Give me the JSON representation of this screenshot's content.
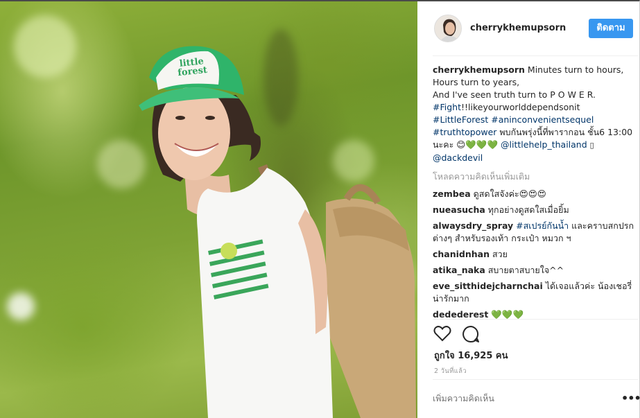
{
  "post": {
    "photo_cap_text": "little forest"
  },
  "header": {
    "username": "cherrykhemupsorn",
    "follow_label": "ติดตาม"
  },
  "caption": {
    "username": "cherrykhemupsorn",
    "line1": "Minutes turn to hours,",
    "line2": "Hours turn to years,",
    "line3": "And I've seen truth turn to P O W E R.",
    "hashtag1": "#Fight",
    "text1": "!!likeyourworlddependsonit",
    "hashtag2": "#LittleForest",
    "hashtag3": "#aninconvenientsequel",
    "hashtag4": "#truthtopower",
    "text2": " พบกันพรุ่งนี้ที่พารากอน ชั้น6 13:00 นะคะ 😊",
    "hearts": "💚💚💚",
    "mention1": "@littlehelp_thailand",
    "mention2": "@dackdevil"
  },
  "load_more": "โหลดความคิดเห็นเพิ่มเติม",
  "comments": [
    {
      "user": "zembea",
      "text": "ดูสดใสจังค่ะ😍😍😍"
    },
    {
      "user": "nueasucha",
      "text": "ทุกอย่างดูสดใสเมื่อยิ้ม"
    },
    {
      "user": "alwaysdry_spray",
      "hashtag": "#สเปรย์กันน้ำ",
      "text": " และคราบสกปรกต่างๆ สำหรับรองเท้า กระเป๋า หมวก ฯ"
    },
    {
      "user": "chanidnhan",
      "text": "สวย"
    },
    {
      "user": "atika_naka",
      "text": "สบายตาสบายใจ^^"
    },
    {
      "user": "eve_sitthidejcharnchai",
      "text": "ได้เจอแล้วค่ะ น้องเชอรี่น่ารักมาก"
    },
    {
      "user": "dedederest",
      "text": "💚💚💚"
    }
  ],
  "actions": {
    "like_icon": "heart-outline-icon",
    "comment_icon": "speech-bubble-icon"
  },
  "likes_text": "ถูกใจ 16,925 คน",
  "time_ago": "2 วันที่แล้ว",
  "add_comment_placeholder": "เพิ่มความคิดเห็น",
  "more_options": "•••",
  "colors": {
    "follow_button": "#3897f0",
    "link": "#003569",
    "muted": "#999999"
  }
}
